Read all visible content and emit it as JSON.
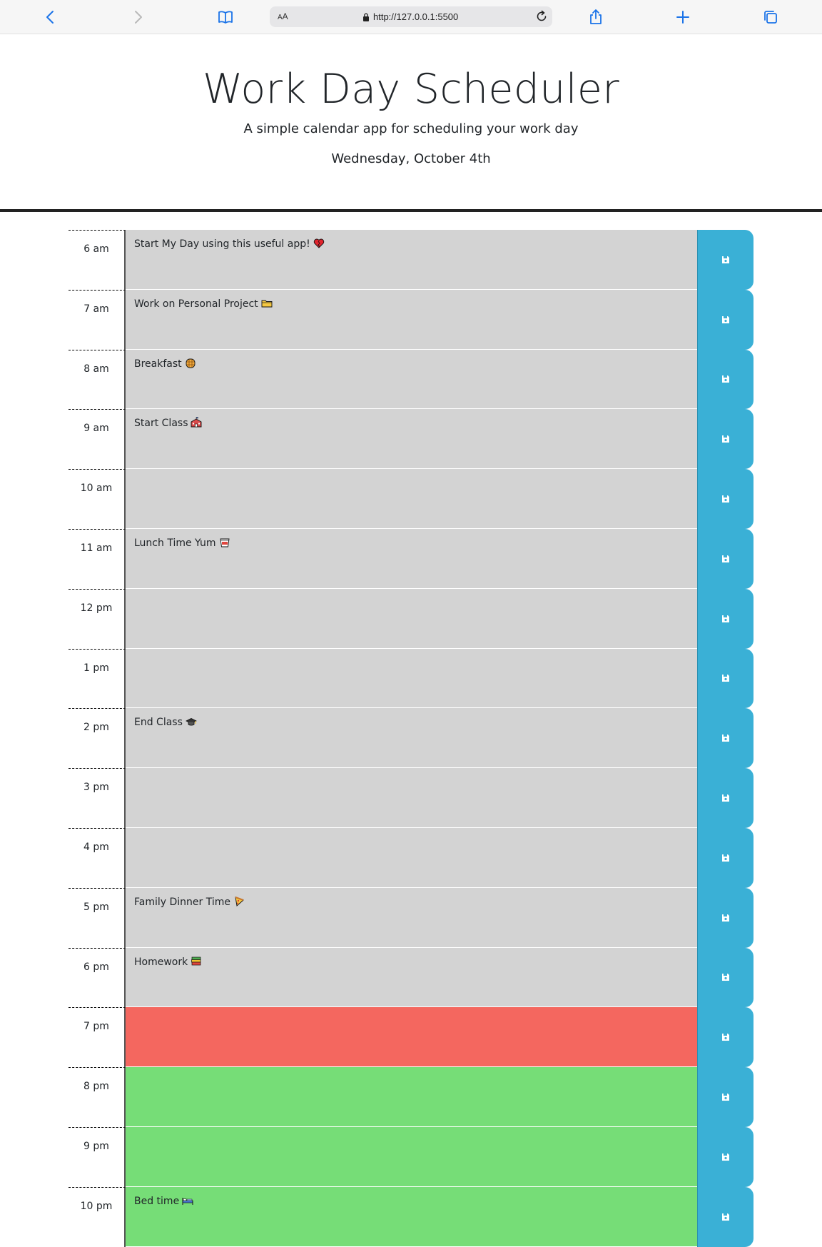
{
  "browser": {
    "aa_label_small": "A",
    "aa_label_large": "A",
    "url": "http://127.0.0.1:5500"
  },
  "header": {
    "title": "Work Day Scheduler",
    "lead": "A simple calendar app for scheduling your work day",
    "current_day": "Wednesday, October 4th"
  },
  "colors": {
    "past": "#d3d3d3",
    "present": "#f4675f",
    "future": "#76dd77",
    "save_button": "#3ab0d6"
  },
  "timeblocks": [
    {
      "hour": "6 am",
      "text": "Start My Day using this useful app!",
      "emoji": "heart-icon",
      "state": "past"
    },
    {
      "hour": "7 am",
      "text": "Work on Personal Project",
      "emoji": "folder-icon",
      "state": "past"
    },
    {
      "hour": "8 am",
      "text": "Breakfast",
      "emoji": "waffle-icon",
      "state": "past"
    },
    {
      "hour": "9 am",
      "text": "Start Class",
      "emoji": "school-icon",
      "state": "past"
    },
    {
      "hour": "10 am",
      "text": "",
      "emoji": "",
      "state": "past"
    },
    {
      "hour": "11 am",
      "text": "Lunch Time Yum",
      "emoji": "takeout-box-icon",
      "state": "past"
    },
    {
      "hour": "12 pm",
      "text": "",
      "emoji": "",
      "state": "past"
    },
    {
      "hour": "1 pm",
      "text": "",
      "emoji": "",
      "state": "past"
    },
    {
      "hour": "2 pm",
      "text": "End Class",
      "emoji": "graduation-cap-icon",
      "state": "past"
    },
    {
      "hour": "3 pm",
      "text": "",
      "emoji": "",
      "state": "past"
    },
    {
      "hour": "4 pm",
      "text": "",
      "emoji": "",
      "state": "past"
    },
    {
      "hour": "5 pm",
      "text": "Family Dinner Time",
      "emoji": "pizza-icon",
      "state": "past"
    },
    {
      "hour": "6 pm",
      "text": "Homework",
      "emoji": "books-icon",
      "state": "past"
    },
    {
      "hour": "7 pm",
      "text": "",
      "emoji": "",
      "state": "present"
    },
    {
      "hour": "8 pm",
      "text": "",
      "emoji": "",
      "state": "future"
    },
    {
      "hour": "9 pm",
      "text": "",
      "emoji": "",
      "state": "future"
    },
    {
      "hour": "10 pm",
      "text": "Bed time",
      "emoji": "bed-icon",
      "state": "future"
    }
  ]
}
